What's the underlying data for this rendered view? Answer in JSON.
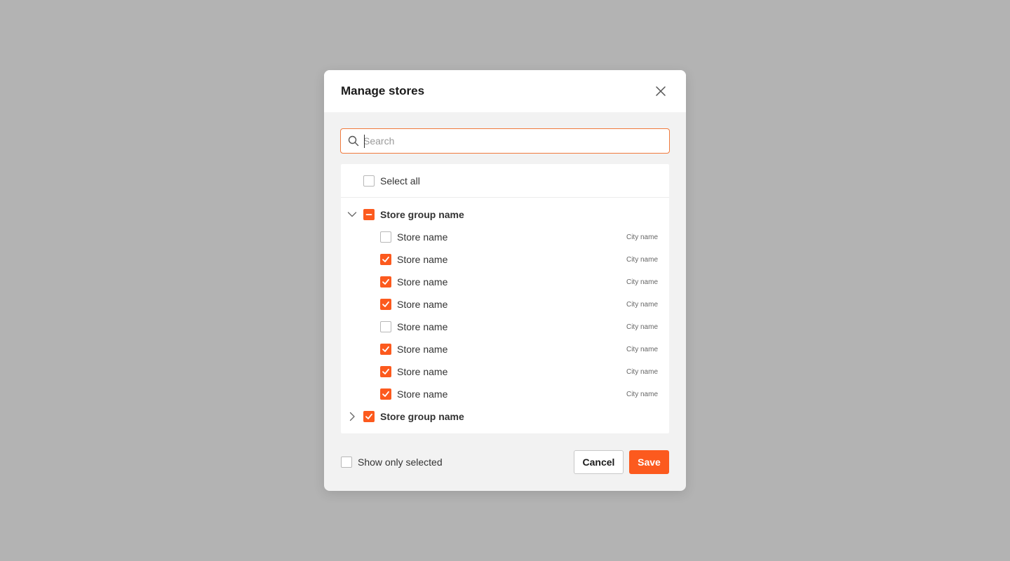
{
  "modal": {
    "title": "Manage stores",
    "close_icon": "close-icon"
  },
  "search": {
    "placeholder": "Search",
    "value": "",
    "icon": "search-icon"
  },
  "list": {
    "select_all_label": "Select all",
    "select_all_checked": false,
    "groups": [
      {
        "label": "Store group name",
        "expanded": true,
        "state": "indeterminate",
        "stores": [
          {
            "label": "Store name",
            "city": "City name",
            "checked": false
          },
          {
            "label": "Store name",
            "city": "City name",
            "checked": true
          },
          {
            "label": "Store name",
            "city": "City name",
            "checked": true
          },
          {
            "label": "Store name",
            "city": "City name",
            "checked": true
          },
          {
            "label": "Store name",
            "city": "City name",
            "checked": false
          },
          {
            "label": "Store name",
            "city": "City name",
            "checked": true
          },
          {
            "label": "Store name",
            "city": "City name",
            "checked": true
          },
          {
            "label": "Store name",
            "city": "City name",
            "checked": true
          }
        ]
      },
      {
        "label": "Store group name",
        "expanded": false,
        "state": "checked",
        "stores": []
      }
    ]
  },
  "footer": {
    "show_only_selected_label": "Show only selected",
    "show_only_selected_checked": false,
    "cancel_label": "Cancel",
    "save_label": "Save"
  },
  "colors": {
    "accent": "#fc5a1e",
    "focus_border": "#f07a3d",
    "backdrop": "#b3b3b3",
    "modal_body": "#f2f2f2"
  }
}
